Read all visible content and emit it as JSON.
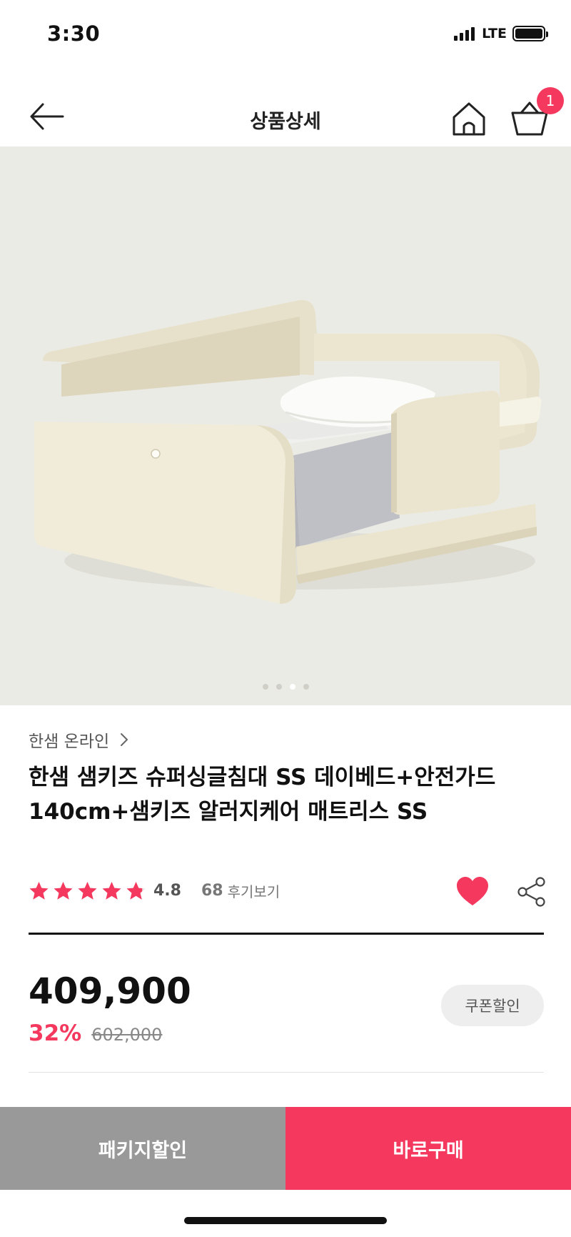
{
  "status_bar": {
    "time": "3:30",
    "network": "LTE",
    "icons": [
      "signal-icon",
      "battery-icon"
    ]
  },
  "nav": {
    "title": "상품상세",
    "cart_badge": "1",
    "icons": [
      "back-arrow-icon",
      "home-icon",
      "cart-icon"
    ]
  },
  "gallery": {
    "page_count": 4,
    "active_index": 2
  },
  "product": {
    "brand": "한샘 온라인",
    "title": "한샘 샘키즈 슈퍼싱글침대 SS 데이베드+안전가드 140cm+샘키즈 알러지케어 매트리스 SS",
    "rating": "4.8",
    "rating_value": 4.8,
    "review_count": "68",
    "review_label": "후기보기",
    "price": "409,900",
    "discount_rate": "32%",
    "original_price": "602,000",
    "coupon_label": "쿠폰할인"
  },
  "colors": {
    "accent": "#f4385e",
    "package_button": "#999999",
    "hero_background": "#ebebe5"
  },
  "bottom_bar": {
    "package_label": "패키지할인",
    "buy_label": "바로구매"
  }
}
